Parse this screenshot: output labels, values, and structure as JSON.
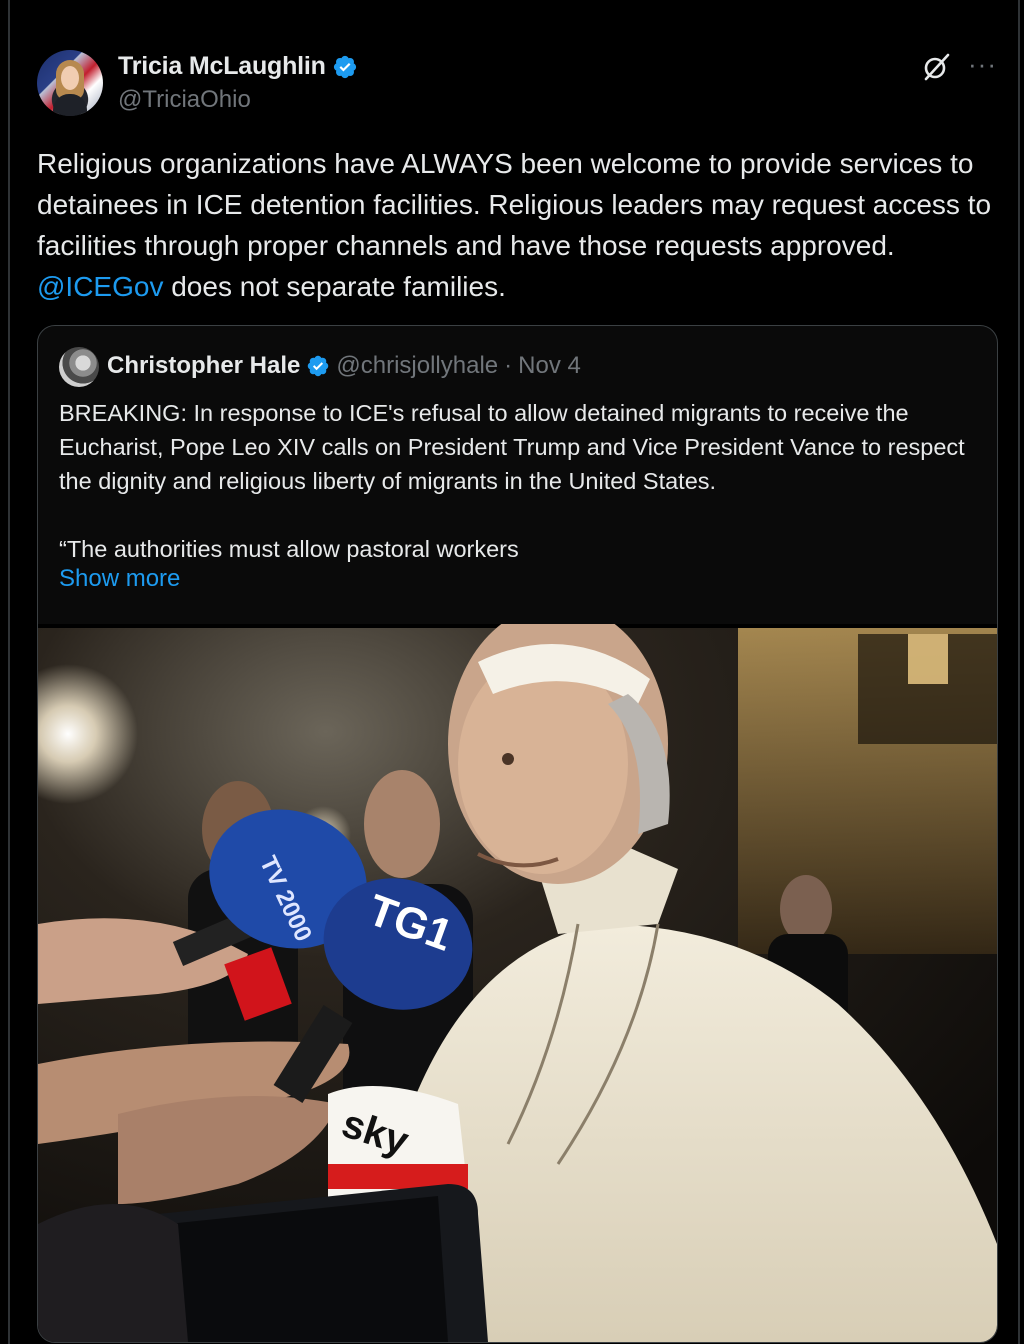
{
  "author": {
    "display_name": "Tricia McLaughlin",
    "handle": "@TriciaOhio",
    "verified": true
  },
  "tweet": {
    "text_before": "Religious organizations have ALWAYS been welcome to provide services to detainees in ICE detention facilities. Religious leaders may request access to facilities through proper channels and have those requests approved. ",
    "mention": "@ICEGov",
    "text_after": " does not separate families."
  },
  "quoted_tweet": {
    "display_name": "Christopher Hale",
    "handle": "@chrisjollyhale",
    "separator": "·",
    "date": "Nov 4",
    "text": "BREAKING: In response to ICE's refusal to allow detained migrants to receive the Eucharist, Pope Leo XIV calls on President Trump and Vice President Vance to respect the dignity and religious liberty of migrants in the United States.\n\n“The authorities must allow pastoral workers",
    "show_more": "Show more"
  },
  "photo": {
    "mic_labels": {
      "tv2000": "TV 2000",
      "tg1": "TG1",
      "sky": "sky"
    }
  },
  "icons": {
    "verified": "verified-badge-icon",
    "grok": "grok-icon",
    "more": "more-options-icon"
  },
  "colors": {
    "link": "#1d9bf0",
    "verified": "#1d9bf0",
    "muted": "#71767b",
    "text": "#e7e9ea",
    "background": "#000000"
  }
}
